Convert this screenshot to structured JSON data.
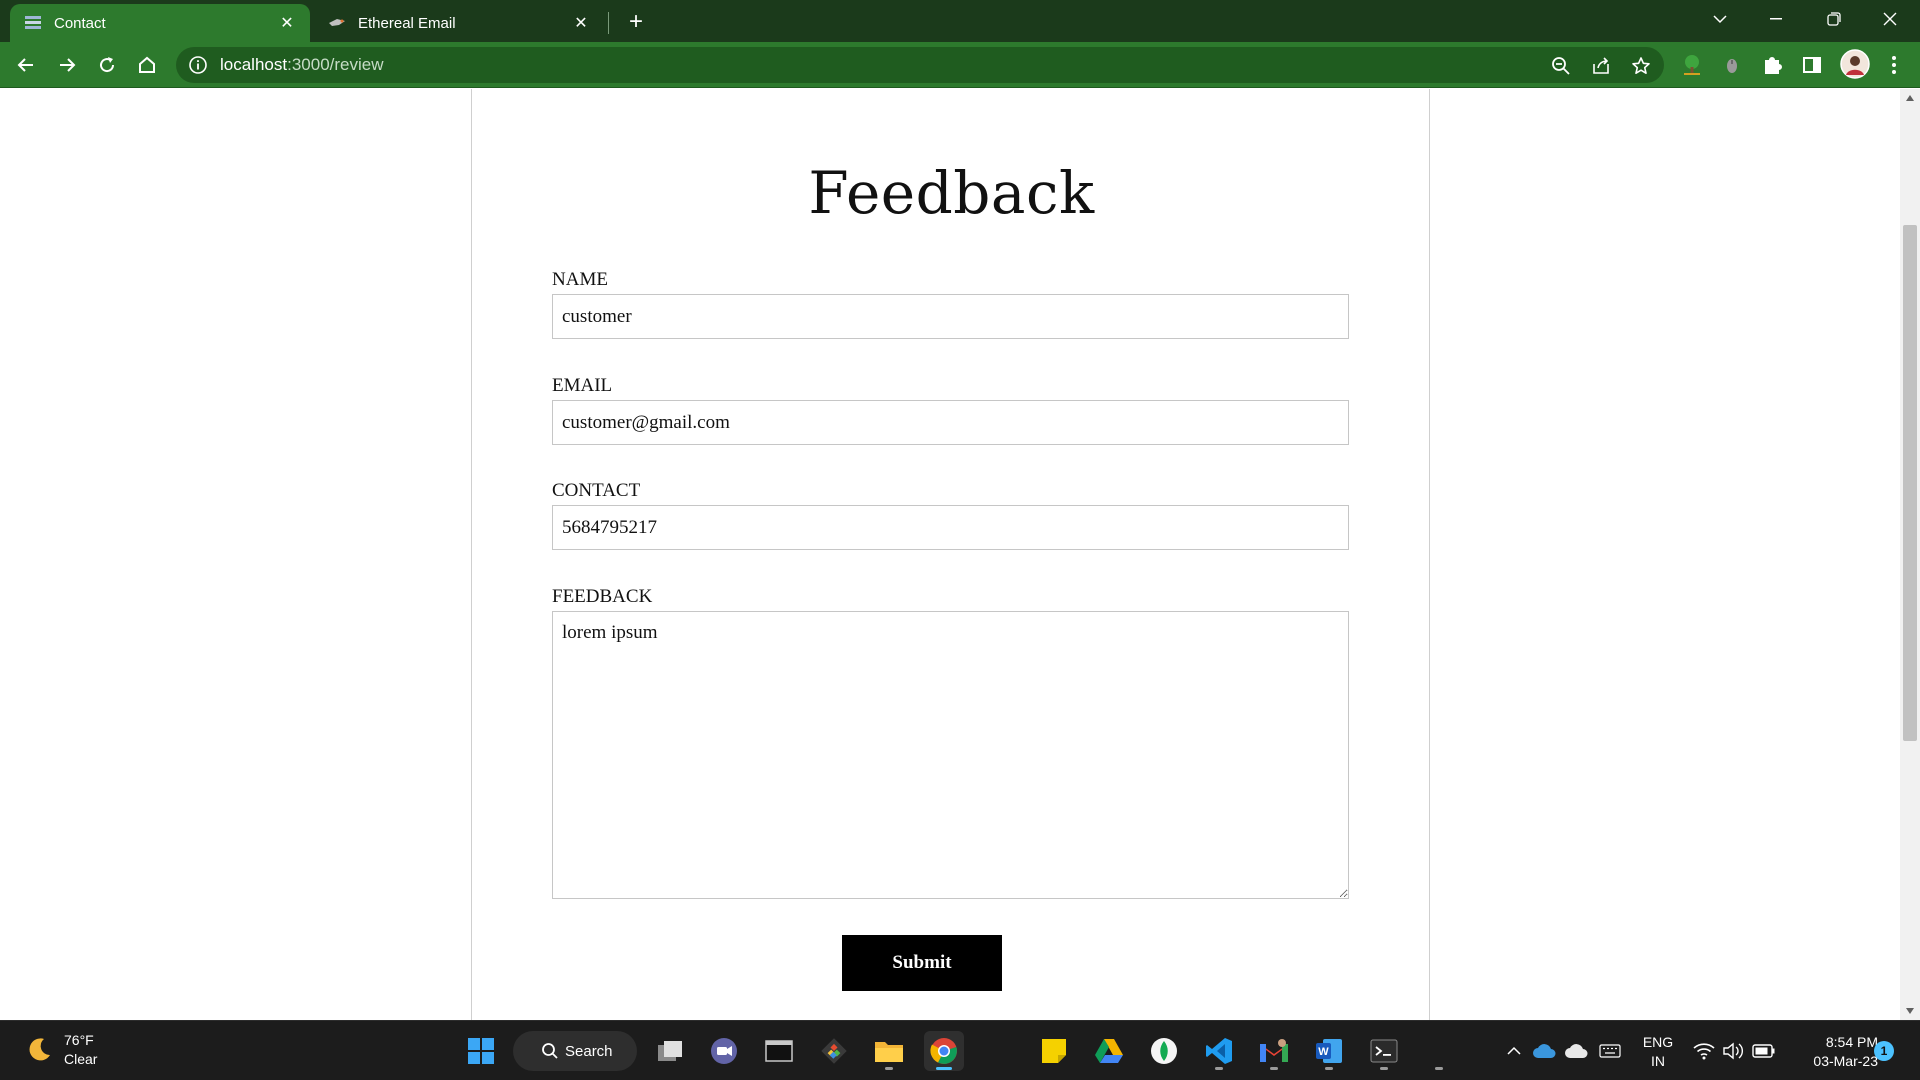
{
  "browser": {
    "tabs": [
      {
        "label": "Contact",
        "active": true
      },
      {
        "label": "Ethereal Email",
        "active": false
      }
    ],
    "url_host": "localhost",
    "url_path": ":3000/review"
  },
  "page": {
    "title": "Feedback",
    "fields": {
      "name_label": "NAME",
      "name_value": "customer",
      "email_label": "EMAIL",
      "email_value": "customer@gmail.com",
      "contact_label": "CONTACT",
      "contact_value": "5684795217",
      "feedback_label": "FEEDBACK",
      "feedback_value": "lorem ipsum"
    },
    "submit_label": "Submit"
  },
  "taskbar": {
    "weather_temp": "76°F",
    "weather_desc": "Clear",
    "search_label": "Search",
    "lang_line1": "ENG",
    "lang_line2": "IN",
    "time": "8:54 PM",
    "date": "03-Mar-23",
    "notification_count": "1"
  },
  "colors": {
    "tab_bar": "#1b3a1b",
    "toolbar": "#2d7a2d",
    "submit_bg": "#000000"
  }
}
